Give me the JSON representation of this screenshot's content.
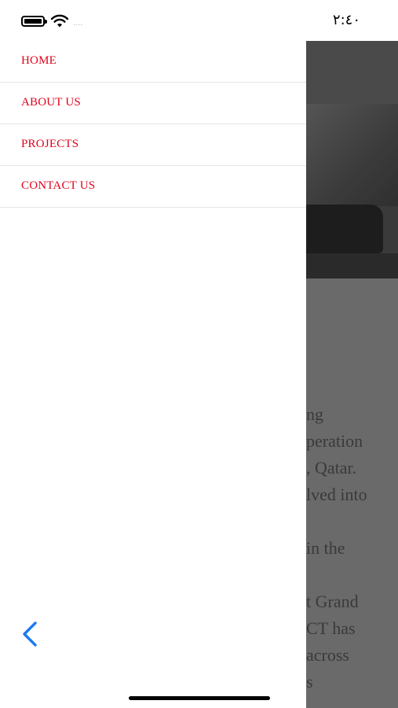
{
  "status_bar": {
    "time": "٢:٤٠",
    "signal_dots": "....",
    "icons": [
      "battery-icon",
      "wifi-icon"
    ]
  },
  "drawer": {
    "menu": [
      {
        "label": "HOME"
      },
      {
        "label": "ABOUT US"
      },
      {
        "label": "PROJECTS"
      },
      {
        "label": "CONTACT US"
      }
    ],
    "back_icon": "chevron-left-icon",
    "accent_color": "#e0001b"
  },
  "background_page": {
    "text_lines": [
      "ng",
      "peration",
      ", Qatar.",
      "lved into",
      "",
      "in the",
      "",
      "t Grand",
      "CT has",
      "across",
      "s"
    ]
  }
}
